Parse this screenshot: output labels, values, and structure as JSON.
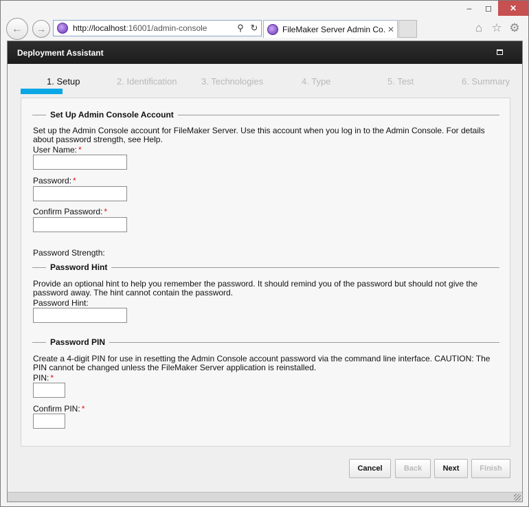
{
  "browser": {
    "url_host": "http://localhost",
    "url_path": ":16001/admin-console",
    "tab_title": "FileMaker Server Admin Co...",
    "icons": {
      "minimize": "window-minimize-icon",
      "maximize": "window-maximize-icon",
      "close": "window-close-icon",
      "back": "back-arrow-icon",
      "forward": "forward-arrow-icon",
      "search": "search-icon",
      "refresh": "refresh-icon",
      "home": "home-icon",
      "favorites": "star-icon",
      "tools": "gear-icon"
    }
  },
  "app": {
    "title": "Deployment Assistant",
    "accent_color": "#0aa7e5",
    "steps": [
      {
        "label": "1. Setup",
        "active": true
      },
      {
        "label": "2. Identification",
        "active": false
      },
      {
        "label": "3. Technologies",
        "active": false
      },
      {
        "label": "4. Type",
        "active": false
      },
      {
        "label": "5. Test",
        "active": false
      },
      {
        "label": "6. Summary",
        "active": false
      }
    ]
  },
  "account": {
    "heading": "Set Up Admin Console Account",
    "description": "Set up the Admin Console account for FileMaker Server. Use this account when you log in to the Admin Console. For details about password strength, see Help.",
    "username_label": "User Name:",
    "password_label": "Password:",
    "confirm_label": "Confirm Password:",
    "strength_label": "Password Strength:",
    "required_mark": "*",
    "username_value": "",
    "password_value": "",
    "confirm_value": ""
  },
  "hint": {
    "heading": "Password Hint",
    "description": "Provide an optional hint to help you remember the password. It should remind you of the password but should not give the password away. The hint cannot contain the password.",
    "label": "Password Hint:",
    "value": ""
  },
  "pin": {
    "heading": "Password PIN",
    "description": "Create a 4-digit PIN for use in resetting the Admin Console account password via the command line interface. CAUTION: The PIN cannot be changed unless the FileMaker Server application is reinstalled.",
    "pin_label": "PIN:",
    "confirm_label": "Confirm PIN:",
    "pin_value": "",
    "confirm_value": ""
  },
  "buttons": {
    "cancel": "Cancel",
    "back": "Back",
    "next": "Next",
    "finish": "Finish"
  }
}
